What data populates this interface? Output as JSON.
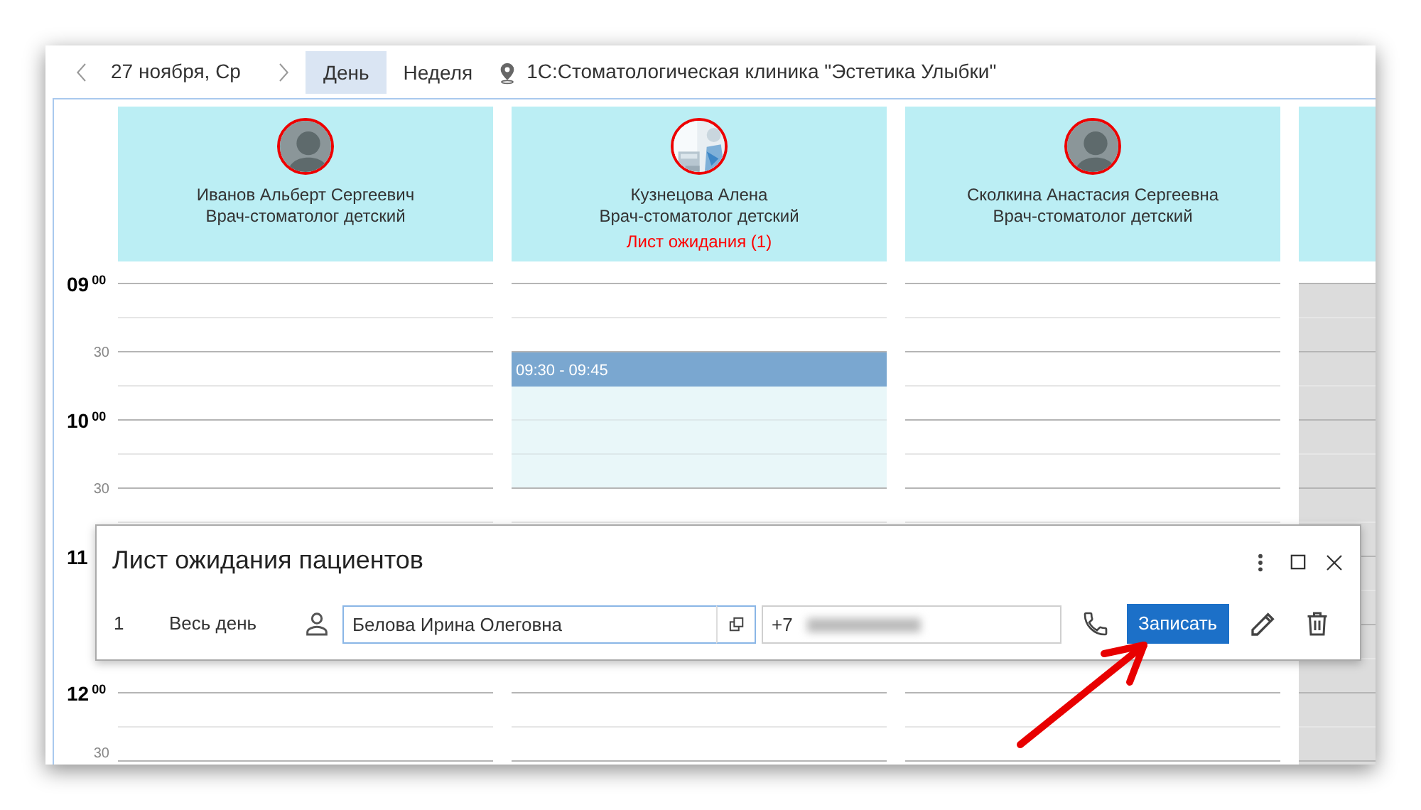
{
  "toolbar": {
    "date": "27 ноября, Ср",
    "views": [
      {
        "label": "День",
        "selected": true
      },
      {
        "label": "Неделя",
        "selected": false
      }
    ],
    "location": "1С:Стоматологическая клиника \"Эстетика Улыбки\""
  },
  "time_slots": [
    {
      "kind": "hour",
      "label": "09",
      "minutes": "00"
    },
    {
      "kind": "half",
      "label": "30"
    },
    {
      "kind": "hour",
      "label": "10",
      "minutes": "00"
    },
    {
      "kind": "half",
      "label": "30"
    },
    {
      "kind": "hour",
      "label": "11"
    },
    {
      "kind": "half"
    },
    {
      "kind": "hour",
      "label": "12",
      "minutes": "00"
    },
    {
      "kind": "half",
      "label": "30"
    }
  ],
  "columns": [
    {
      "kind": "doctor",
      "avatar": {
        "kind": "silhouette"
      },
      "name": "Иванов Альберт Сергеевич",
      "role": "Врач-стоматолог детский"
    },
    {
      "kind": "doctor",
      "name": "Кузнецова Алена",
      "role": "Врач-стоматолог детский",
      "waitlist": "Лист ожидания (1)",
      "appointment": {
        "time": "09:30 - 09:45"
      }
    },
    {
      "kind": "doctor",
      "avatar": {
        "kind": "silhouette"
      },
      "name": "Сколкина Анастасия Сергеевна",
      "role": "Врач-стоматолог детский"
    },
    {
      "kind": "unavailable"
    }
  ],
  "dialog": {
    "title": "Лист ожидания пациентов",
    "rows": [
      {
        "number": "1",
        "period": "Весь день",
        "patient": "Белова Ирина Олеговна",
        "phone": "+7",
        "action": "Записать"
      }
    ]
  }
}
